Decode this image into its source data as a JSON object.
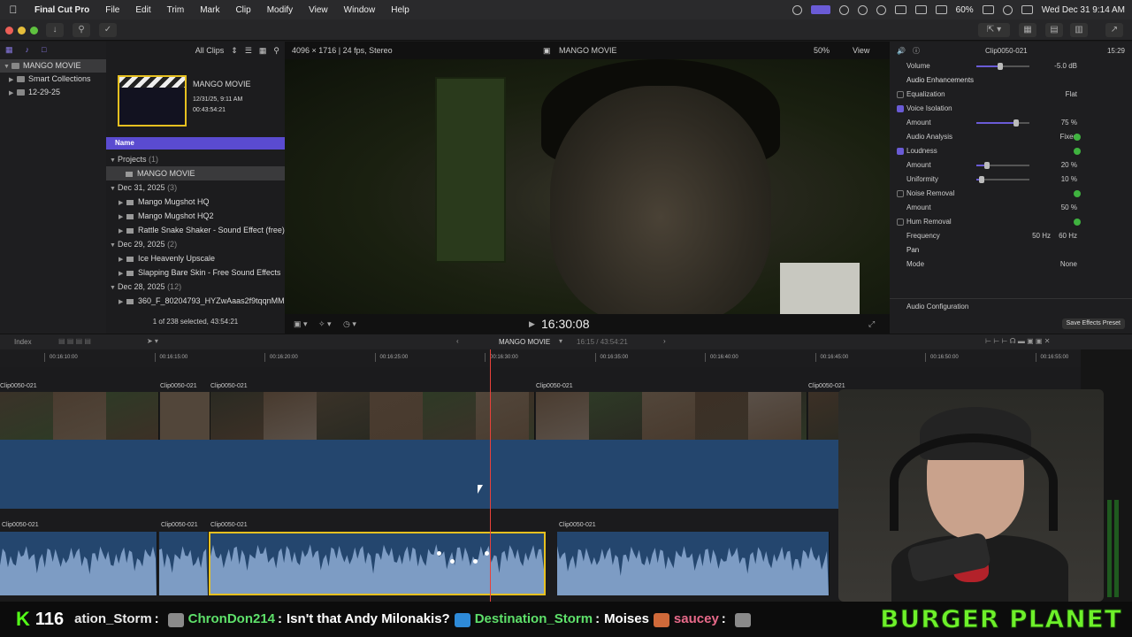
{
  "menubar": {
    "app": "Final Cut Pro",
    "items": [
      "File",
      "Edit",
      "Trim",
      "Mark",
      "Clip",
      "Modify",
      "View",
      "Window",
      "Help"
    ],
    "battery": "60%",
    "datetime": "Wed Dec 31  9:14 AM"
  },
  "library": {
    "items": [
      {
        "label": "MANGO MOVIE"
      },
      {
        "label": "Smart Collections"
      },
      {
        "label": "12-29-25"
      }
    ]
  },
  "browser": {
    "filter": "All Clips",
    "project_thumb": {
      "title": "MANGO MOVIE",
      "date": "12/31/25, 9:11 AM",
      "duration": "00:43:54:21"
    },
    "name_header": "Name",
    "rows": [
      {
        "kind": "group",
        "label": "Projects",
        "count": "(1)"
      },
      {
        "kind": "proj",
        "label": "MANGO MOVIE"
      },
      {
        "kind": "group",
        "label": "Dec 31, 2025",
        "count": "(3)"
      },
      {
        "kind": "item",
        "label": "Mango Mugshot HQ"
      },
      {
        "kind": "item",
        "label": "Mango Mugshot HQ2"
      },
      {
        "kind": "item",
        "label": "Rattle Snake Shaker - Sound Effect (free)"
      },
      {
        "kind": "group",
        "label": "Dec 29, 2025",
        "count": "(2)"
      },
      {
        "kind": "item",
        "label": "Ice Heavenly Upscale"
      },
      {
        "kind": "item",
        "label": "Slapping Bare Skin - Free Sound Effects"
      },
      {
        "kind": "group",
        "label": "Dec 28, 2025",
        "count": "(12)"
      },
      {
        "kind": "item",
        "label": "360_F_80204793_HYZwAaas2f9tqqnMM"
      }
    ],
    "selection_count": "1 of 238 selected, 43:54:21"
  },
  "viewer": {
    "format": "4096 × 1716 | 24 fps, Stereo",
    "title": "MANGO MOVIE",
    "zoom": "50%",
    "view_label": "View",
    "timecode": "16:30:08"
  },
  "inspector": {
    "clip_name": "Clip0050-021",
    "clip_duration": "15:29",
    "rows": [
      {
        "label": "Volume",
        "value": "-5.0",
        "unit": "dB",
        "checkbox": null,
        "slider": 0.45
      },
      {
        "label": "Audio Enhancements",
        "section": true
      },
      {
        "label": "Equalization",
        "value": "Flat",
        "checkbox": false
      },
      {
        "label": "Voice Isolation",
        "checkbox": true
      },
      {
        "label": "Amount",
        "value": "75",
        "unit": "%",
        "slider": 0.75
      },
      {
        "label": "Audio Analysis",
        "value": "Fixed",
        "green": true
      },
      {
        "label": "Loudness",
        "checkbox": true,
        "green": true
      },
      {
        "label": "Amount",
        "value": "20",
        "unit": "%",
        "slider": 0.2
      },
      {
        "label": "Uniformity",
        "value": "10",
        "unit": "%",
        "slider": 0.1
      },
      {
        "label": "Noise Removal",
        "checkbox": false,
        "green": true
      },
      {
        "label": "Amount",
        "value": "50",
        "unit": "%"
      },
      {
        "label": "Hum Removal",
        "checkbox": false,
        "green": true
      },
      {
        "label": "Frequency",
        "value": "50",
        "unit": "Hz",
        "value2": "60 Hz"
      },
      {
        "label": "Pan",
        "section": true
      },
      {
        "label": "Mode",
        "value": "None"
      }
    ],
    "audio_config": "Audio Configuration",
    "save_preset": "Save Effects Preset"
  },
  "timeline": {
    "index_label": "Index",
    "project": "MANGO MOVIE",
    "position": "16:15 / 43:54:21",
    "ruler": [
      "00:16:10:00",
      "00:16:15:00",
      "00:16:20:00",
      "00:16:25:00",
      "00:16:30:00",
      "00:16:35:00",
      "00:16:40:00",
      "00:16:45:00",
      "00:16:50:00",
      "00:16:55:00"
    ],
    "clip_name": "Clip0050-021"
  },
  "chat": {
    "viewer_count": "116",
    "messages": [
      {
        "user": "ation_Storm",
        "sep": ":",
        "text": "",
        "color": "#e8e8e8"
      },
      {
        "user": "ChronDon214",
        "sep": ":",
        "text": "Isn't that Andy Milonakis?",
        "color": "#5ee06a"
      },
      {
        "user": "Destination_Storm",
        "sep": ":",
        "text": "Moises",
        "color": "#5ee06a"
      },
      {
        "user": "saucey",
        "sep": ":",
        "text": "",
        "color": "#e86a8a"
      }
    ],
    "banner": "BURGER PLANET"
  }
}
